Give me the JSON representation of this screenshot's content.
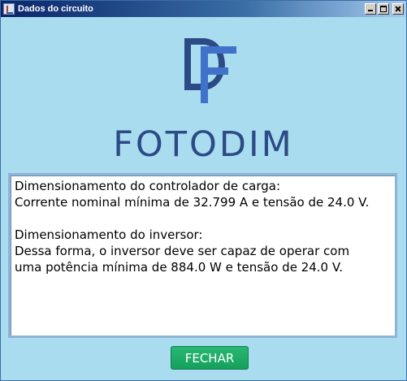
{
  "window": {
    "title": "Dados do circuito"
  },
  "brand": {
    "name": "FOTODIM",
    "color": "#2c4a86"
  },
  "result": {
    "controller_heading": "Dimensionamento do controlador de carga:",
    "controller_text": "Corrente nominal mínima de 32.799 A e tensão de 24.0 V.",
    "inverter_heading": "Dimensionamento do inversor:",
    "inverter_text_line1": "Dessa forma, o inversor deve ser capaz de operar com",
    "inverter_text_line2": "uma potência mínima de 884.0 W e tensão de 24.0 V."
  },
  "actions": {
    "close_label": "FECHAR",
    "close_color": "#1aa865"
  },
  "colors": {
    "background": "#a8dcee",
    "titlebar": "#0a246a"
  }
}
